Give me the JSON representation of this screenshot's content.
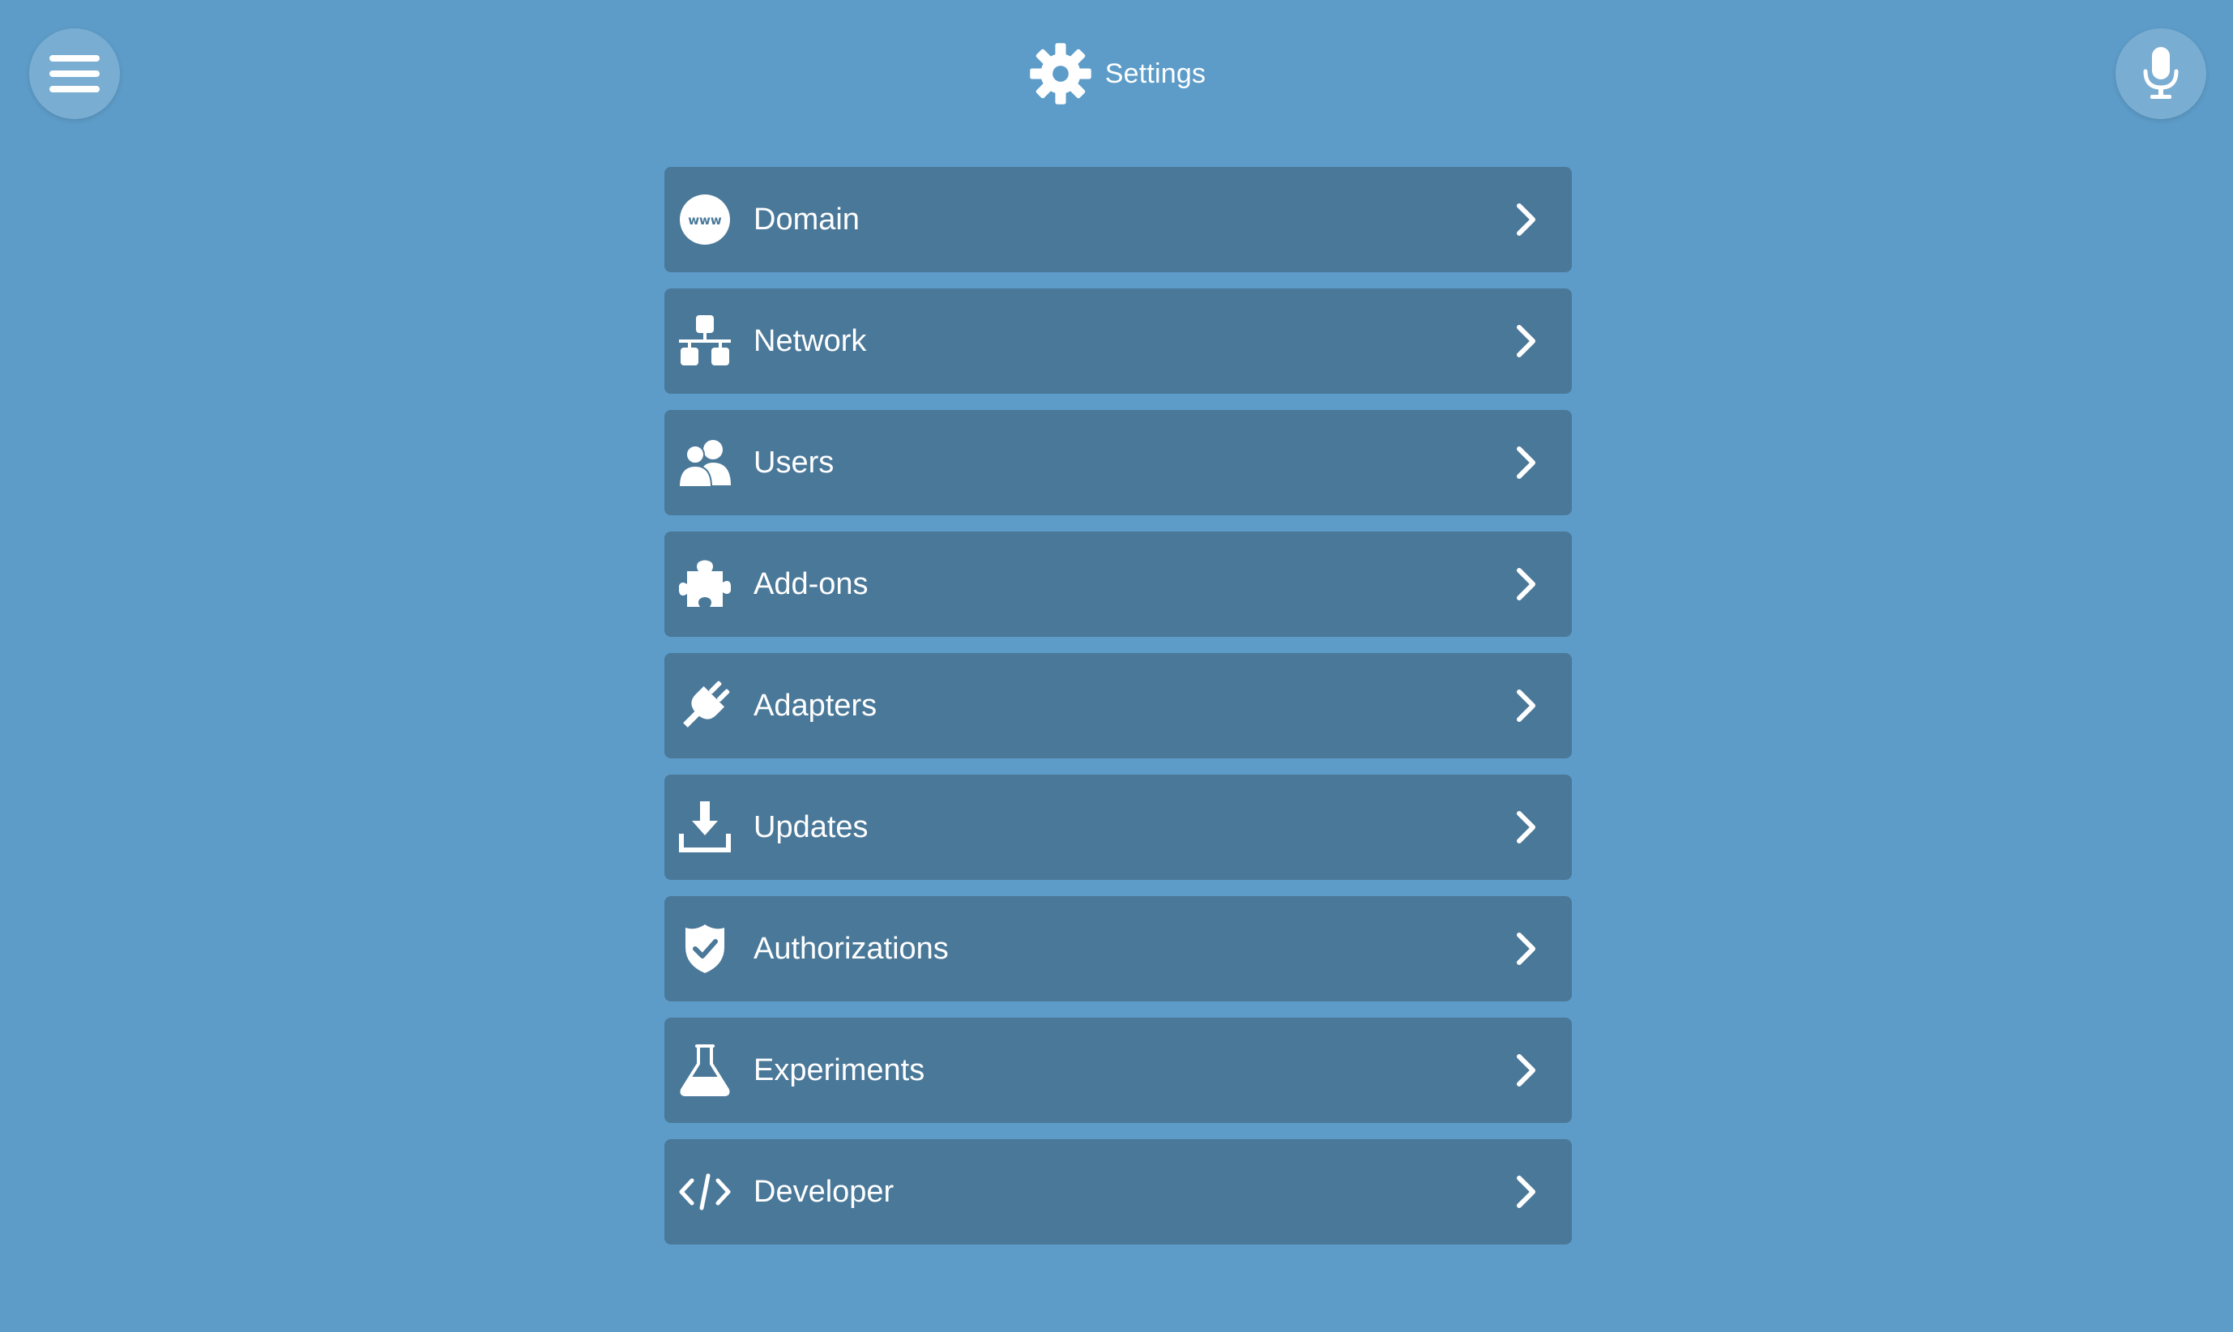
{
  "header": {
    "title": "Settings",
    "icon": "gear-icon"
  },
  "toolbar": {
    "menu_icon": "hamburger-menu-icon",
    "mic_icon": "microphone-icon"
  },
  "settings": {
    "items": [
      {
        "label": "Domain",
        "icon": "www-globe-icon"
      },
      {
        "label": "Network",
        "icon": "network-icon"
      },
      {
        "label": "Users",
        "icon": "users-icon"
      },
      {
        "label": "Add-ons",
        "icon": "puzzle-piece-icon"
      },
      {
        "label": "Adapters",
        "icon": "plug-icon"
      },
      {
        "label": "Updates",
        "icon": "download-icon"
      },
      {
        "label": "Authorizations",
        "icon": "shield-check-icon"
      },
      {
        "label": "Experiments",
        "icon": "flask-icon"
      },
      {
        "label": "Developer",
        "icon": "code-icon"
      }
    ]
  },
  "colors": {
    "background": "#5d9cc8",
    "item_background": "#4a7899",
    "text": "#ffffff"
  }
}
